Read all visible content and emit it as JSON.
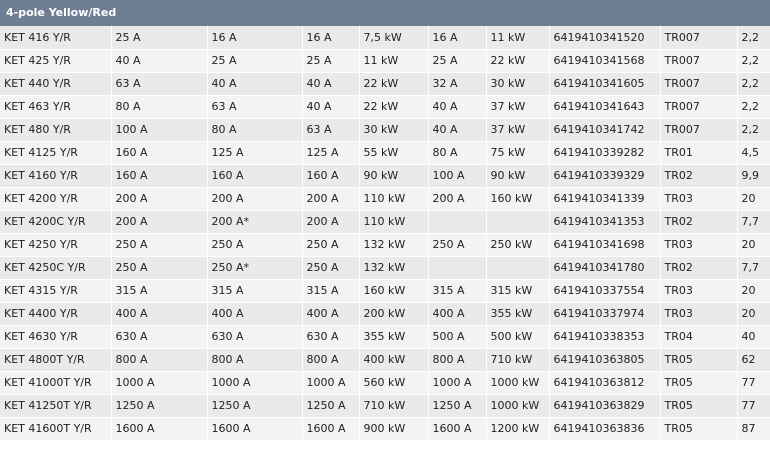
{
  "title": "4-pole Yellow/Red",
  "rows": [
    [
      "KET 416 Y/R",
      "25 A",
      "16 A",
      "16 A",
      "7,5 kW",
      "16 A",
      "11 kW",
      "6419410341520",
      "TR007",
      "2,2"
    ],
    [
      "KET 425 Y/R",
      "40 A",
      "25 A",
      "25 A",
      "11 kW",
      "25 A",
      "22 kW",
      "6419410341568",
      "TR007",
      "2,2"
    ],
    [
      "KET 440 Y/R",
      "63 A",
      "40 A",
      "40 A",
      "22 kW",
      "32 A",
      "30 kW",
      "6419410341605",
      "TR007",
      "2,2"
    ],
    [
      "KET 463 Y/R",
      "80 A",
      "63 A",
      "40 A",
      "22 kW",
      "40 A",
      "37 kW",
      "6419410341643",
      "TR007",
      "2,2"
    ],
    [
      "KET 480 Y/R",
      "100 A",
      "80 A",
      "63 A",
      "30 kW",
      "40 A",
      "37 kW",
      "6419410341742",
      "TR007",
      "2,2"
    ],
    [
      "KET 4125 Y/R",
      "160 A",
      "125 A",
      "125 A",
      "55 kW",
      "80 A",
      "75 kW",
      "6419410339282",
      "TR01",
      "4,5"
    ],
    [
      "KET 4160 Y/R",
      "160 A",
      "160 A",
      "160 A",
      "90 kW",
      "100 A",
      "90 kW",
      "6419410339329",
      "TR02",
      "9,9"
    ],
    [
      "KET 4200 Y/R",
      "200 A",
      "200 A",
      "200 A",
      "110 kW",
      "200 A",
      "160 kW",
      "6419410341339",
      "TR03",
      "20"
    ],
    [
      "KET 4200C Y/R",
      "200 A",
      "200 A*",
      "200 A",
      "110 kW",
      "",
      "",
      "6419410341353",
      "TR02",
      "7,7"
    ],
    [
      "KET 4250 Y/R",
      "250 A",
      "250 A",
      "250 A",
      "132 kW",
      "250 A",
      "250 kW",
      "6419410341698",
      "TR03",
      "20"
    ],
    [
      "KET 4250C Y/R",
      "250 A",
      "250 A*",
      "250 A",
      "132 kW",
      "",
      "",
      "6419410341780",
      "TR02",
      "7,7"
    ],
    [
      "KET 4315 Y/R",
      "315 A",
      "315 A",
      "315 A",
      "160 kW",
      "315 A",
      "315 kW",
      "6419410337554",
      "TR03",
      "20"
    ],
    [
      "KET 4400 Y/R",
      "400 A",
      "400 A",
      "400 A",
      "200 kW",
      "400 A",
      "355 kW",
      "6419410337974",
      "TR03",
      "20"
    ],
    [
      "KET 4630 Y/R",
      "630 A",
      "630 A",
      "630 A",
      "355 kW",
      "500 A",
      "500 kW",
      "6419410338353",
      "TR04",
      "40"
    ],
    [
      "KET 4800T Y/R",
      "800 A",
      "800 A",
      "800 A",
      "400 kW",
      "800 A",
      "710 kW",
      "6419410363805",
      "TR05",
      "62"
    ],
    [
      "KET 41000T Y/R",
      "1000 A",
      "1000 A",
      "1000 A",
      "560 kW",
      "1000 A",
      "1000 kW",
      "6419410363812",
      "TR05",
      "77"
    ],
    [
      "KET 41250T Y/R",
      "1250 A",
      "1250 A",
      "1250 A",
      "710 kW",
      "1250 A",
      "1000 kW",
      "6419410363829",
      "TR05",
      "77"
    ],
    [
      "KET 41600T Y/R",
      "1600 A",
      "1600 A",
      "1600 A",
      "900 kW",
      "1600 A",
      "1200 kW",
      "6419410363836",
      "TR05",
      "87"
    ]
  ]
}
